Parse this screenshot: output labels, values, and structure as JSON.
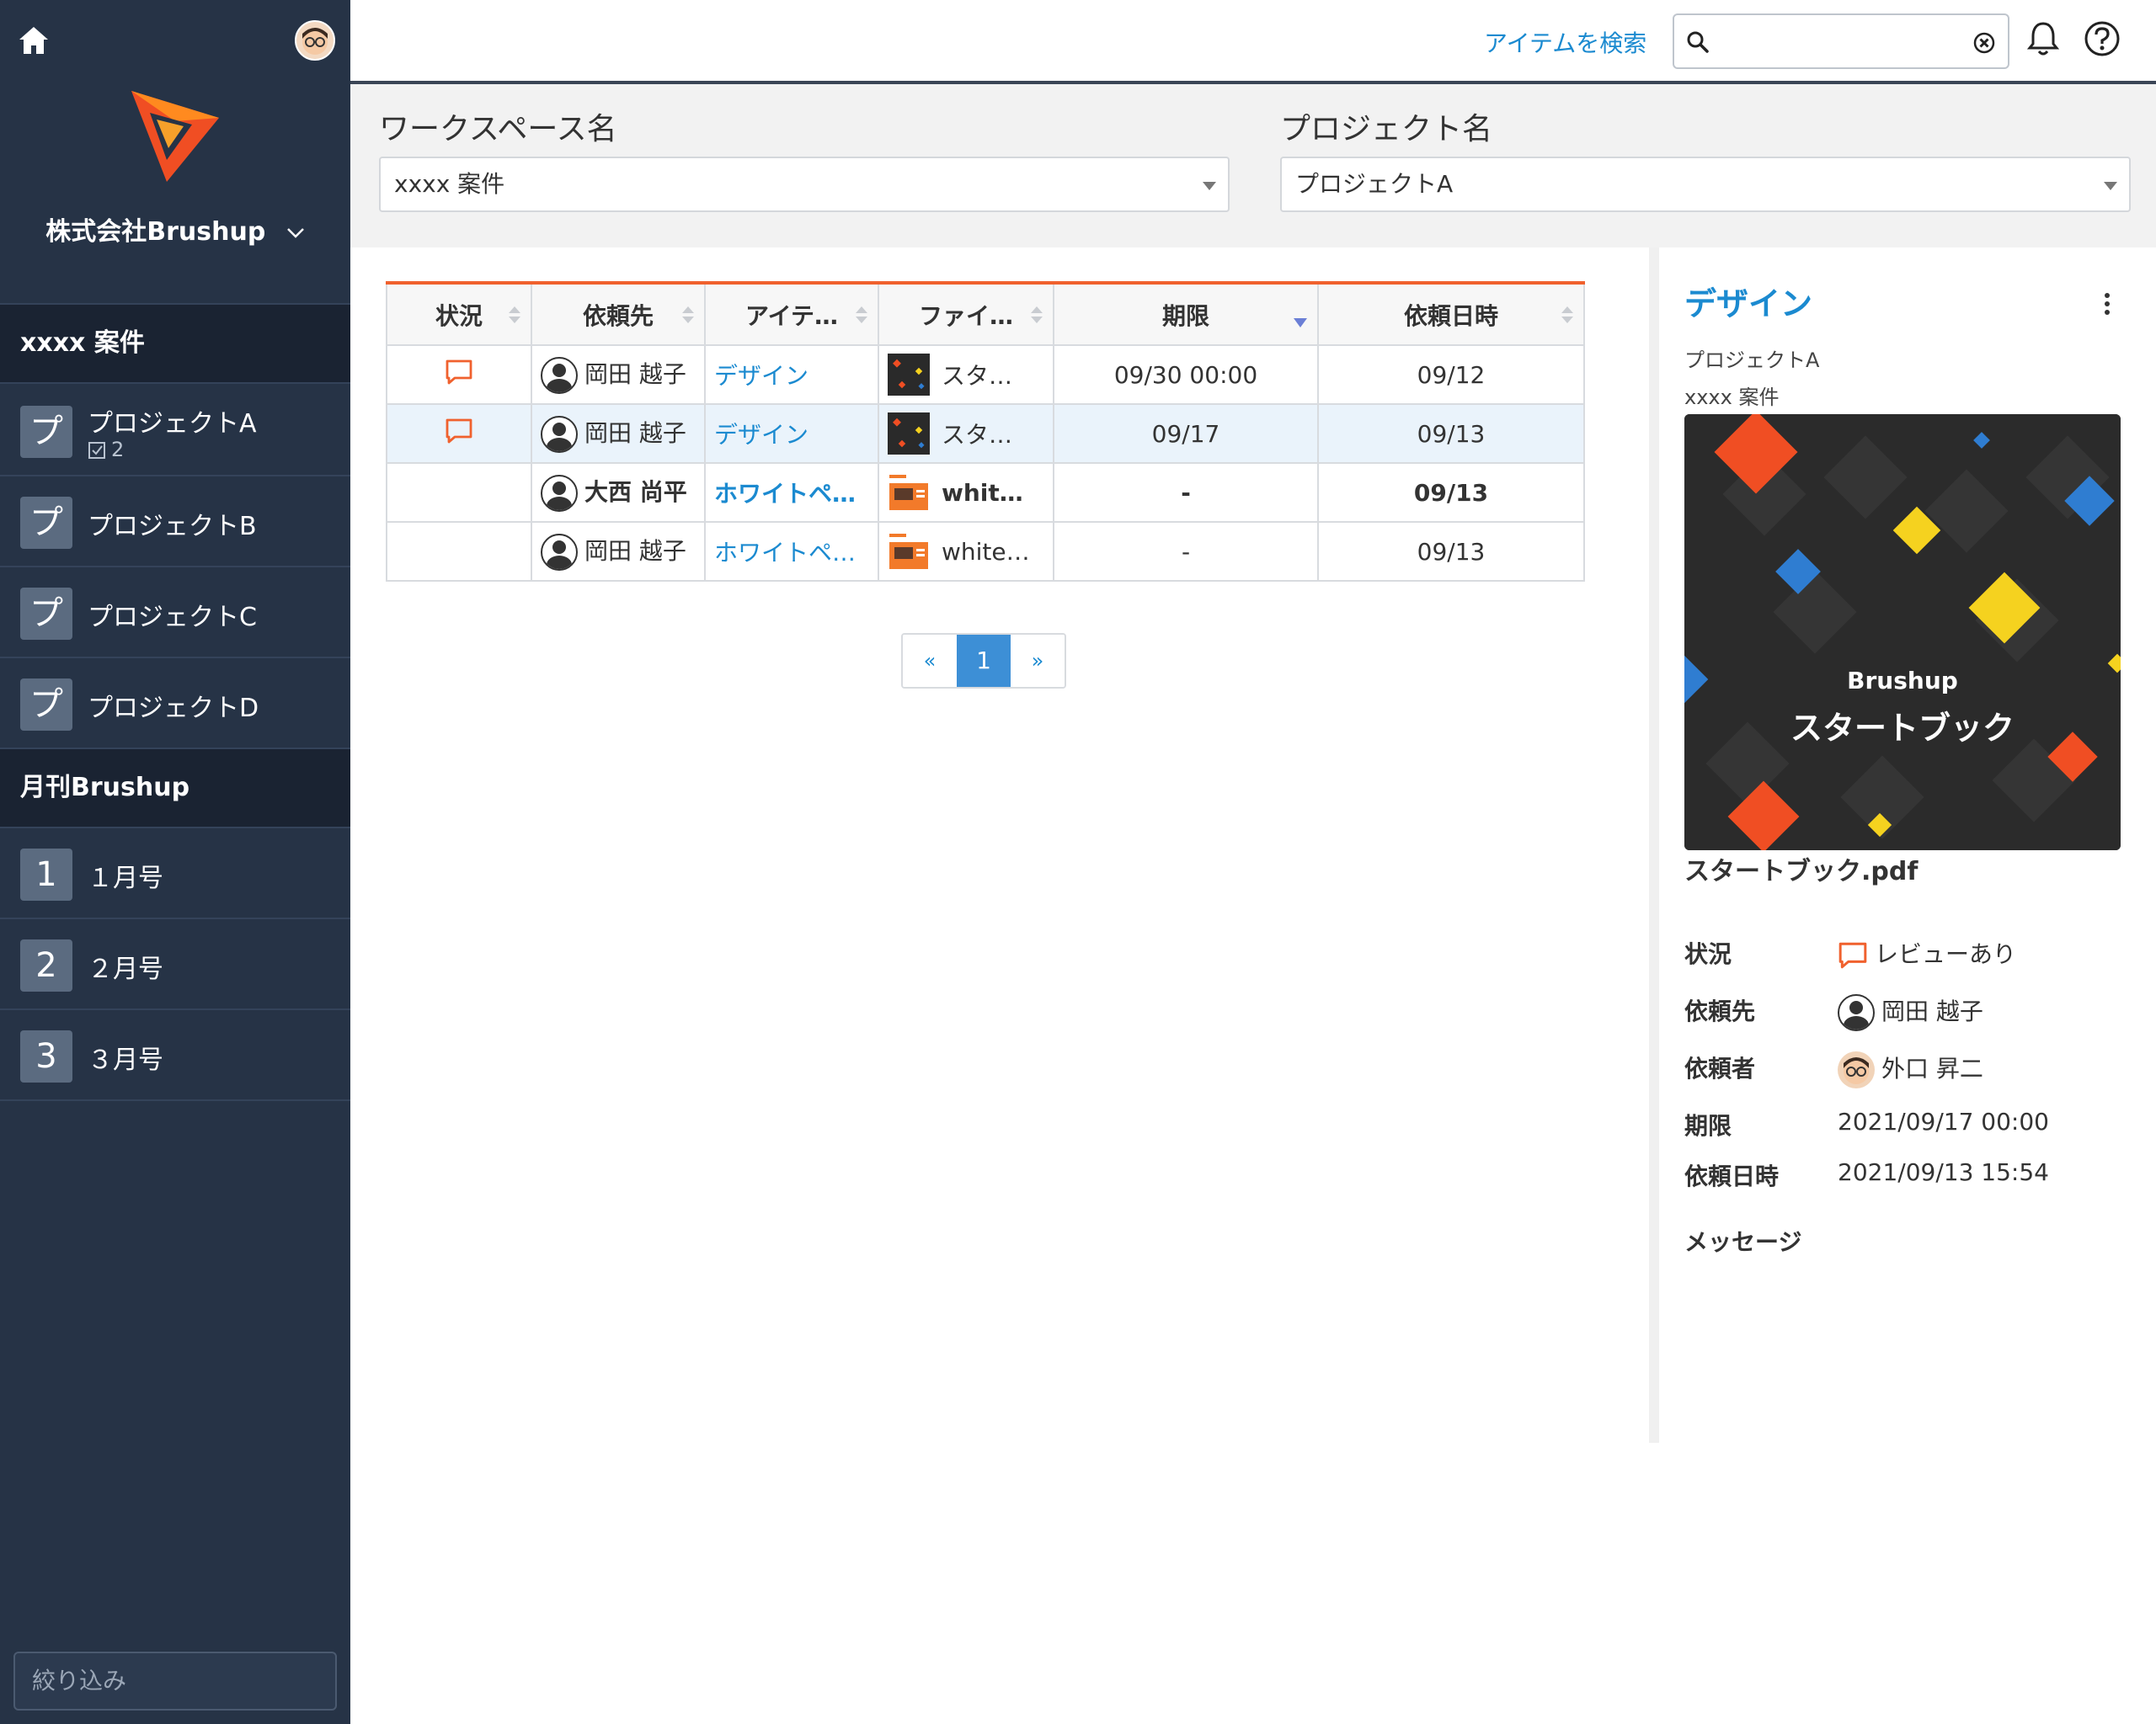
{
  "sidebar": {
    "company": "株式会社Brushup",
    "groups": [
      {
        "title": "xxxx 案件",
        "items": [
          {
            "icon": "プ",
            "label": "プロジェクトA",
            "badge": "2"
          },
          {
            "icon": "プ",
            "label": "プロジェクトB"
          },
          {
            "icon": "プ",
            "label": "プロジェクトC"
          },
          {
            "icon": "プ",
            "label": "プロジェクトD"
          }
        ]
      },
      {
        "title": "月刊Brushup",
        "items": [
          {
            "icon": "1",
            "label": "１月号"
          },
          {
            "icon": "2",
            "label": "２月号"
          },
          {
            "icon": "3",
            "label": "３月号"
          }
        ]
      }
    ],
    "filter_placeholder": "絞り込み"
  },
  "topbar": {
    "search_link": "アイテムを検索",
    "search_value": ""
  },
  "filters": {
    "workspace_label": "ワークスペース名",
    "workspace_value": "xxxx 案件",
    "project_label": "プロジェクト名",
    "project_value": "プロジェクトA"
  },
  "table": {
    "headers": [
      "状況",
      "依頼先",
      "アイテ…",
      "ファイ…",
      "期限",
      "依頼日時"
    ],
    "rows": [
      {
        "status": "review",
        "assignee": "岡田 越子",
        "item": "デザイン",
        "file": "スター…",
        "due": "09/30 00:00",
        "requested": "09/12"
      },
      {
        "status": "review",
        "assignee": "岡田 越子",
        "item": "デザイン",
        "file": "スター…",
        "due": "09/17",
        "requested": "09/13"
      },
      {
        "status": "",
        "assignee": "大西 尚平",
        "item": "ホワイトペ…",
        "file": "white…",
        "due": "-",
        "requested": "09/13"
      },
      {
        "status": "",
        "assignee": "岡田 越子",
        "item": "ホワイトペ…",
        "file": "white…",
        "due": "-",
        "requested": "09/13"
      }
    ]
  },
  "pagination": {
    "prev": "«",
    "current": "1",
    "next": "»"
  },
  "detail": {
    "title": "デザイン",
    "project": "プロジェクトA",
    "workspace": "xxxx 案件",
    "preview_brand": "Brushup",
    "preview_title": "スタートブック",
    "filename": "スタートブック.pdf",
    "fields": {
      "status_label": "状況",
      "status_value": "レビューあり",
      "assignee_label": "依頼先",
      "assignee_value": "岡田 越子",
      "requester_label": "依頼者",
      "requester_value": "外口 昇二",
      "due_label": "期限",
      "due_value": "2021/09/17 00:00",
      "requested_label": "依頼日時",
      "requested_value": "2021/09/13 15:54"
    },
    "message_label": "メッセージ"
  },
  "colors": {
    "accent": "#1b8ad0",
    "brand_orange": "#f0612e",
    "sidebar_bg": "#263346"
  }
}
